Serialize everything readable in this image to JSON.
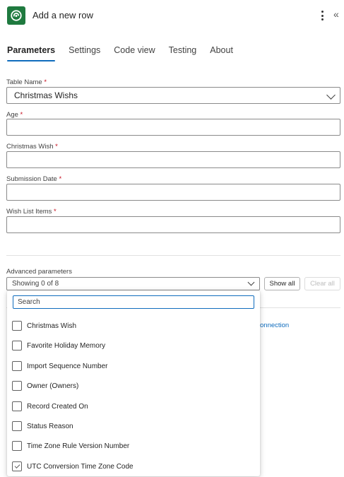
{
  "header": {
    "title": "Add a new row",
    "app_icon": "dataverse-icon",
    "more_icon": "more-vertical-icon",
    "collapse_icon": "collapse-panel-icon",
    "collapse_glyph": "«",
    "accent": "#1f7a3f"
  },
  "tabs": [
    {
      "label": "Parameters",
      "active": true
    },
    {
      "label": "Settings",
      "active": false
    },
    {
      "label": "Code view",
      "active": false
    },
    {
      "label": "Testing",
      "active": false
    },
    {
      "label": "About",
      "active": false
    }
  ],
  "fields": {
    "table_name": {
      "label": "Table Name",
      "required_mark": "*",
      "value": "Christmas Wishs"
    },
    "age": {
      "label": "Age",
      "required_mark": "*",
      "value": ""
    },
    "christmas_wish": {
      "label": "Christmas Wish",
      "required_mark": "*",
      "value": ""
    },
    "submission_date": {
      "label": "Submission Date",
      "required_mark": "*",
      "value": ""
    },
    "wish_list_items": {
      "label": "Wish List Items",
      "required_mark": "*",
      "value": ""
    }
  },
  "advanced": {
    "label": "Advanced parameters",
    "select_value": "Showing 0 of 8",
    "show_all": "Show all",
    "clear_all": "Clear all",
    "connection_link": "onnection"
  },
  "dropdown": {
    "search_placeholder": "Search",
    "options": [
      {
        "label": "Christmas Wish",
        "checked": false
      },
      {
        "label": "Favorite Holiday Memory",
        "checked": false
      },
      {
        "label": "Import Sequence Number",
        "checked": false
      },
      {
        "label": "Owner (Owners)",
        "checked": false
      },
      {
        "label": "Record Created On",
        "checked": false
      },
      {
        "label": "Status Reason",
        "checked": false
      },
      {
        "label": "Time Zone Rule Version Number",
        "checked": false
      },
      {
        "label": "UTC Conversion Time Zone Code",
        "checked": true
      }
    ]
  },
  "colors": {
    "link": "#0f6cbd",
    "tab_underline": "#0f6cbd",
    "required": "#c50f1f"
  }
}
